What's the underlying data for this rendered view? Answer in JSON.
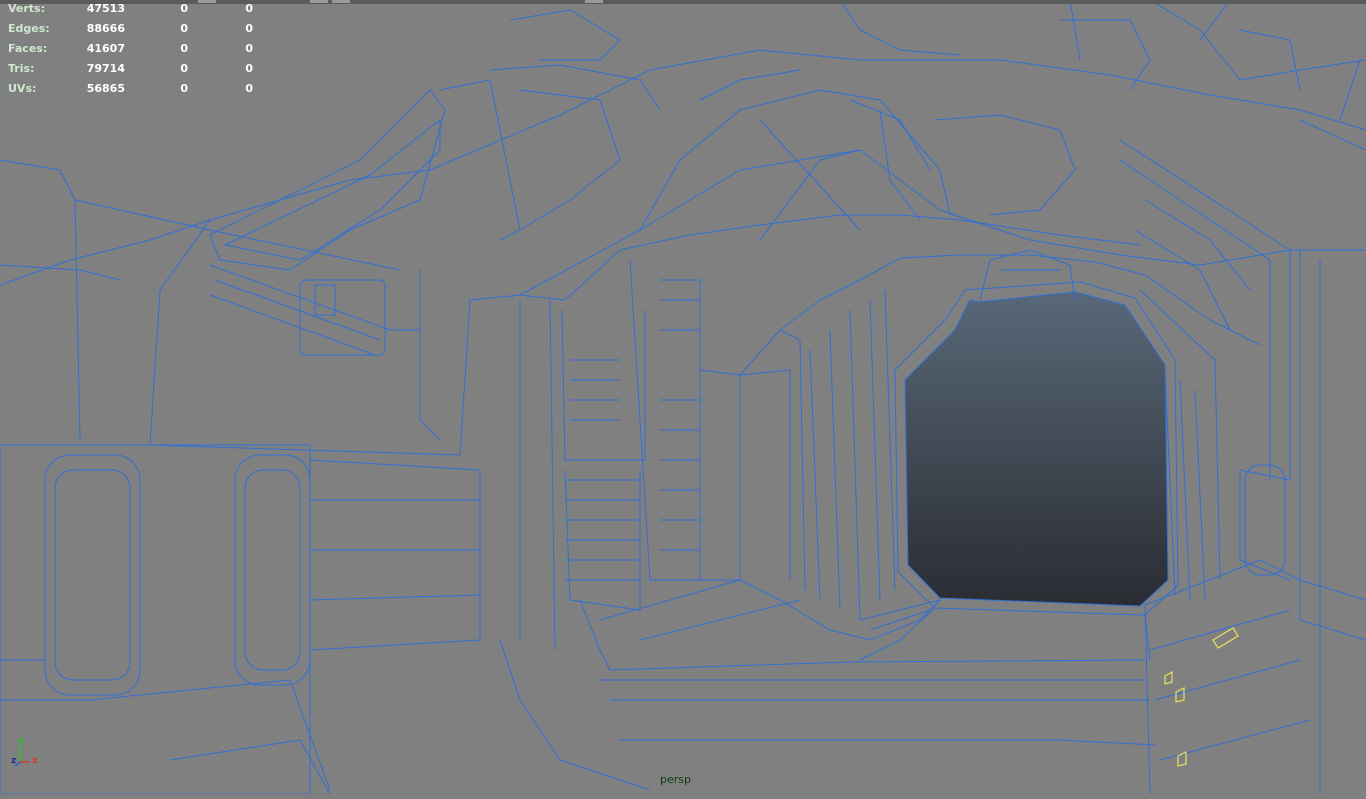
{
  "hud": {
    "rows": [
      {
        "label": "Verts:",
        "v1": "47513",
        "v2": "0",
        "v3": "0"
      },
      {
        "label": "Edges:",
        "v1": "88666",
        "v2": "0",
        "v3": "0"
      },
      {
        "label": "Faces:",
        "v1": "41607",
        "v2": "0",
        "v3": "0"
      },
      {
        "label": "Tris:",
        "v1": "79714",
        "v2": "0",
        "v3": "0"
      },
      {
        "label": "UVs:",
        "v1": "56865",
        "v2": "0",
        "v3": "0"
      }
    ]
  },
  "viewport": {
    "camera": "persp",
    "axis": {
      "y": "y",
      "z": "z",
      "x": "x"
    }
  },
  "colors": {
    "background": "#808080",
    "wireframe": "#2f6fd6",
    "selection": "#e8e060",
    "opening_top": "#586878",
    "opening_bottom": "#2a2c32"
  }
}
